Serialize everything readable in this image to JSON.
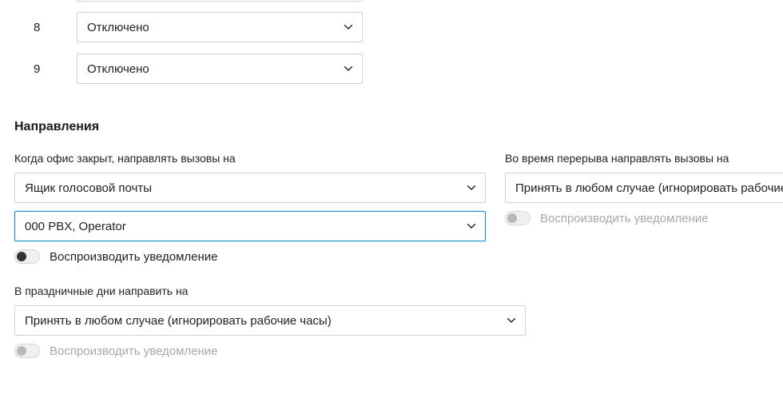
{
  "slots": [
    {
      "number": "8",
      "value": "Отключено"
    },
    {
      "number": "9",
      "value": "Отключено"
    }
  ],
  "section_title": "Направления",
  "closed": {
    "label": "Когда офис закрыт, направлять вызовы на",
    "dest1": "Ящик голосовой почты",
    "dest2": "000 PBX, Operator",
    "toggle_label": "Воспроизводить уведомление"
  },
  "break": {
    "label": "Во время перерыва направлять вызовы на",
    "value": "Принять в любом случае (игнорировать рабочие часы)",
    "toggle_label": "Воспроизводить уведомление"
  },
  "holidays": {
    "label": "В праздничные дни направить на",
    "value": "Принять в любом случае (игнорировать рабочие часы)",
    "toggle_label": "Воспроизводить уведомление"
  }
}
